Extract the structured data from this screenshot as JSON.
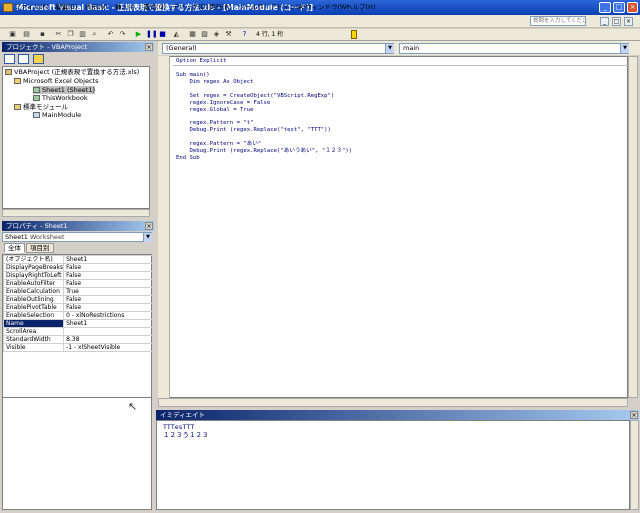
{
  "titlebar": {
    "title": "Microsoft Visual Basic - 正規表現で置換する方法.xls - [MainModule (コード)]",
    "min": "_",
    "max": "□",
    "close": "×"
  },
  "menu": [
    "ファイル(F)",
    "編集(E)",
    "表示(V)",
    "挿入(I)",
    "書式(O)",
    "デバッグ(D)",
    "実行(R)",
    "ツール(T)",
    "アドイン(A)",
    "ウィンドウ(W)",
    "ヘルプ(H)"
  ],
  "help_search": {
    "placeholder": "質問を入力してください"
  },
  "toolbar": {
    "position": "4 行, 1 桁"
  },
  "project": {
    "title": "プロジェクト - VBAProject",
    "tree": [
      {
        "label": "VBAProject (正規表現で置換する方法.xls)",
        "level": 0
      },
      {
        "label": "Microsoft Excel Objects",
        "level": 1
      },
      {
        "label": "Sheet1 (Sheet1)",
        "level": 2,
        "selected": true
      },
      {
        "label": "ThisWorkbook",
        "level": 2
      },
      {
        "label": "標準モジュール",
        "level": 1
      },
      {
        "label": "MainModule",
        "level": 2
      }
    ]
  },
  "properties": {
    "title": "プロパティ - Sheet1",
    "object": "Sheet1",
    "object_type": "Worksheet",
    "tabs": [
      "全体",
      "項目別"
    ],
    "rows": [
      {
        "key": "(オブジェクト名)",
        "value": "Sheet1"
      },
      {
        "key": "DisplayPageBreaks",
        "value": "False"
      },
      {
        "key": "DisplayRightToLeft",
        "value": "False"
      },
      {
        "key": "EnableAutoFilter",
        "value": "False"
      },
      {
        "key": "EnableCalculation",
        "value": "True"
      },
      {
        "key": "EnableOutlining",
        "value": "False"
      },
      {
        "key": "EnablePivotTable",
        "value": "False"
      },
      {
        "key": "EnableSelection",
        "value": "0 - xlNoRestrictions"
      },
      {
        "key": "Name",
        "value": "Sheet1",
        "selected": true
      },
      {
        "key": "ScrollArea",
        "value": ""
      },
      {
        "key": "StandardWidth",
        "value": "8.38"
      },
      {
        "key": "Visible",
        "value": "-1 - xlSheetVisible"
      }
    ]
  },
  "code": {
    "object_dropdown": "(General)",
    "proc_dropdown": "main",
    "declaration": "Option Explicit",
    "lines": [
      "Sub main()",
      "    Dim regex As Object",
      "",
      "    Set regex = CreateObject(\"VBScript.RegExp\")",
      "    regex.IgnoreCase = False",
      "    regex.Global = True",
      "",
      "    regex.Pattern = \"t\"",
      "    Debug.Print (regex.Replace(\"test\", \"TTT\"))",
      "",
      "    regex.Pattern = \"あい\"",
      "    Debug.Print (regex.Replace(\"あいうあい\", \"１２３\"))",
      "End Sub"
    ]
  },
  "immediate": {
    "title": "イミディエイト",
    "lines": [
      "TTTesTTT",
      "１２３う１２３"
    ]
  }
}
